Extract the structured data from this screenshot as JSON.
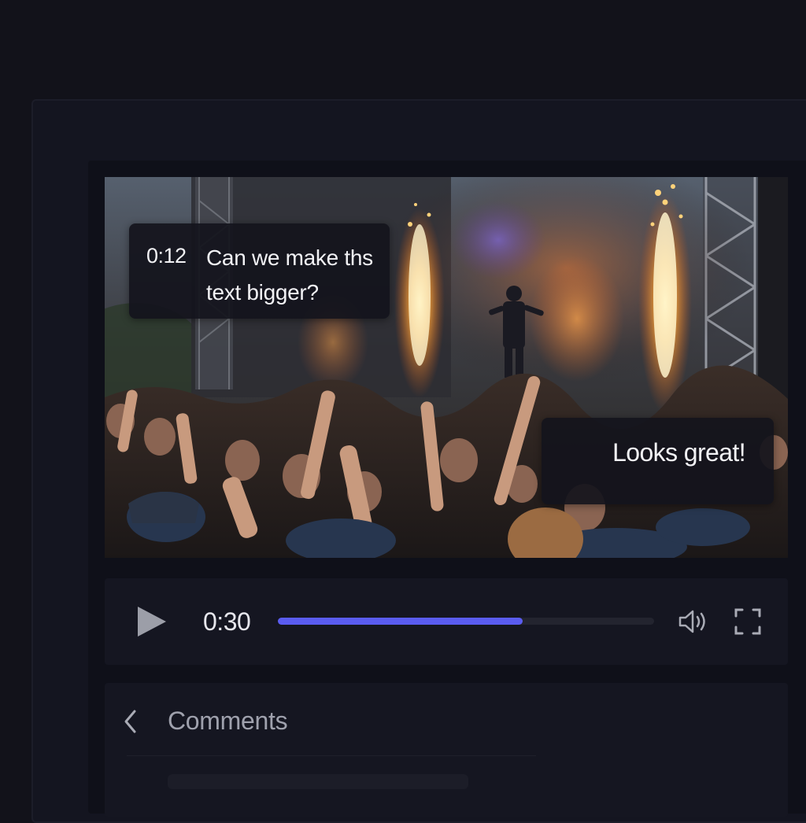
{
  "video": {
    "scene": "concert crowd with stage pyrotechnics",
    "comments_overlay": [
      {
        "timestamp": "0:12",
        "text": "Can we make ths text bigger?"
      },
      {
        "timestamp": "",
        "text": "Looks great!"
      }
    ]
  },
  "player": {
    "current_time": "0:30",
    "progress": 0.65,
    "play_icon": "play-icon",
    "volume_icon": "volume-icon",
    "fullscreen_icon": "fullscreen-icon",
    "accent_color": "#5a5cf0"
  },
  "comments": {
    "title": "Comments",
    "back_icon": "chevron-left-icon"
  }
}
